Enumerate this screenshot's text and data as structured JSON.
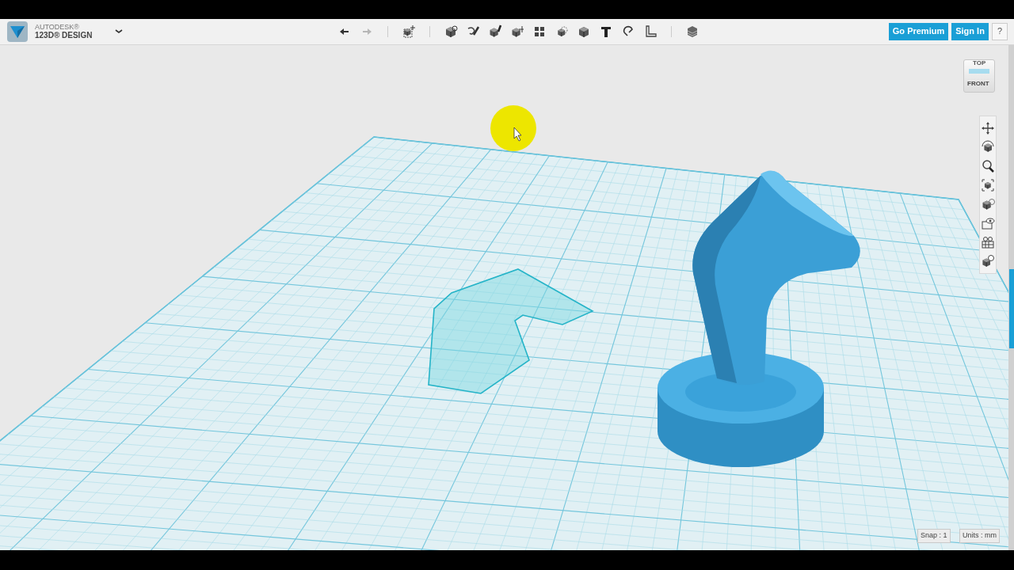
{
  "app": {
    "company": "AUTODESK®",
    "product": "123D® DESIGN"
  },
  "history": [
    {
      "disabled": false
    },
    {
      "disabled": true
    }
  ],
  "account_buttons": [
    {
      "label": "Go Premium",
      "kind": "primary"
    },
    {
      "label": "Sign In",
      "kind": "primary"
    },
    {
      "label": "?",
      "kind": "help"
    }
  ],
  "view_cube": {
    "top": "TOP",
    "front": "FRONT"
  },
  "status_bar": {
    "snap": "Snap : 1",
    "units": "Units : mm"
  }
}
